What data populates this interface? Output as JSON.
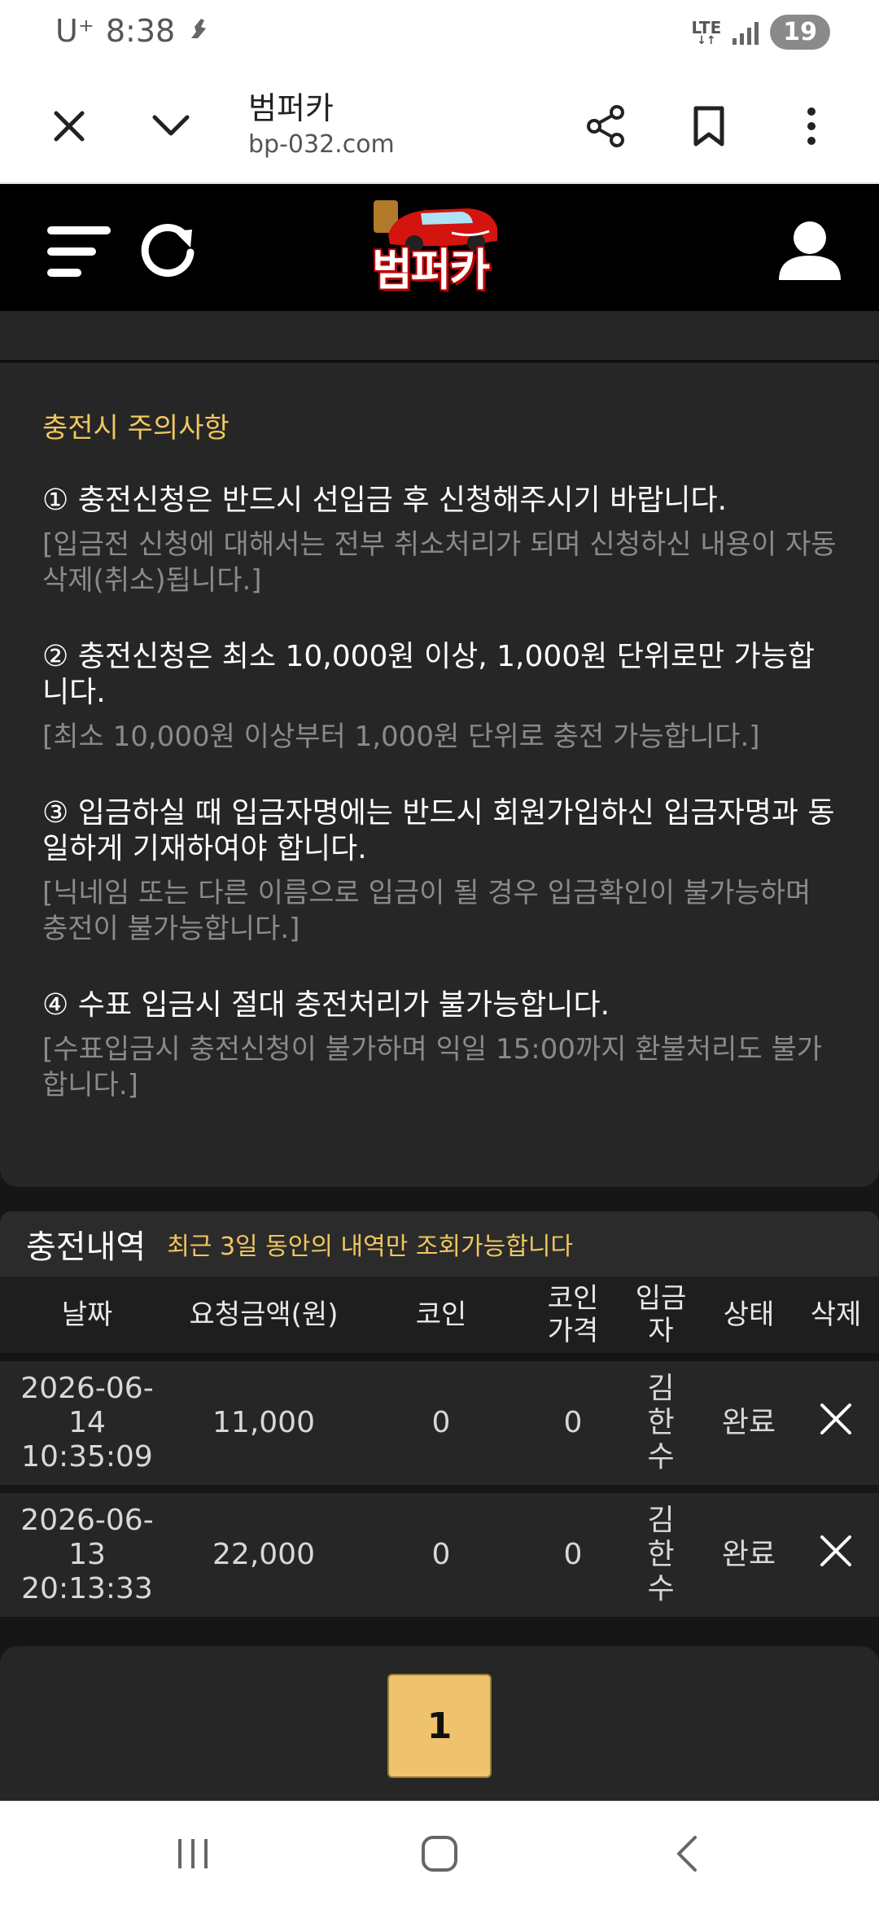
{
  "status_bar": {
    "carrier": "U⁺",
    "time": "8:38",
    "network": "LTE",
    "battery": "19"
  },
  "browser": {
    "title": "범퍼카",
    "url": "bp-032.com"
  },
  "site": {
    "logo_text": "범퍼카"
  },
  "notice": {
    "heading": "충전시 주의사항",
    "items": [
      {
        "main": "① 충전신청은 반드시 선입금 후 신청해주시기 바랍니다.",
        "sub": "[입금전 신청에 대해서는 전부 취소처리가 되며 신청하신 내용이 자동 삭제(취소)됩니다.]"
      },
      {
        "main": "② 충전신청은 최소 10,000원 이상, 1,000원 단위로만 가능합니다.",
        "sub": "[최소 10,000원 이상부터 1,000원 단위로 충전 가능합니다.]"
      },
      {
        "main": "③ 입금하실 때 입금자명에는 반드시 회원가입하신 입금자명과 동일하게 기재하여야 합니다.",
        "sub": "[닉네임 또는 다른 이름으로 입금이 될 경우 입금확인이 불가능하며 충전이 불가능합니다.]"
      },
      {
        "main": "④ 수표 입금시 절대 충전처리가 불가능합니다.",
        "sub": "[수표입금시 충전신청이 불가하며 익일 15:00까지 환불처리도 불가합니다.]"
      }
    ]
  },
  "history": {
    "title": "충전내역",
    "note": "최근 3일 동안의 내역만 조회가능합니다",
    "columns": [
      "날짜",
      "요청금액(원)",
      "코인",
      "코인가격",
      "입금자",
      "상태",
      "삭제"
    ],
    "rows": [
      {
        "date": "2026-06-14",
        "time": "10:35:09",
        "amount": "11,000",
        "coin": "0",
        "coin_price": "0",
        "depositor": "김한수",
        "status": "완료"
      },
      {
        "date": "2026-06-13",
        "time": "20:13:33",
        "amount": "22,000",
        "coin": "0",
        "coin_price": "0",
        "depositor": "김한수",
        "status": "완료"
      }
    ]
  },
  "pagination": {
    "current_page": "1"
  },
  "colors": {
    "accent_gold": "#f0c75e",
    "page_button": "#efc36d",
    "panel": "#262626"
  }
}
